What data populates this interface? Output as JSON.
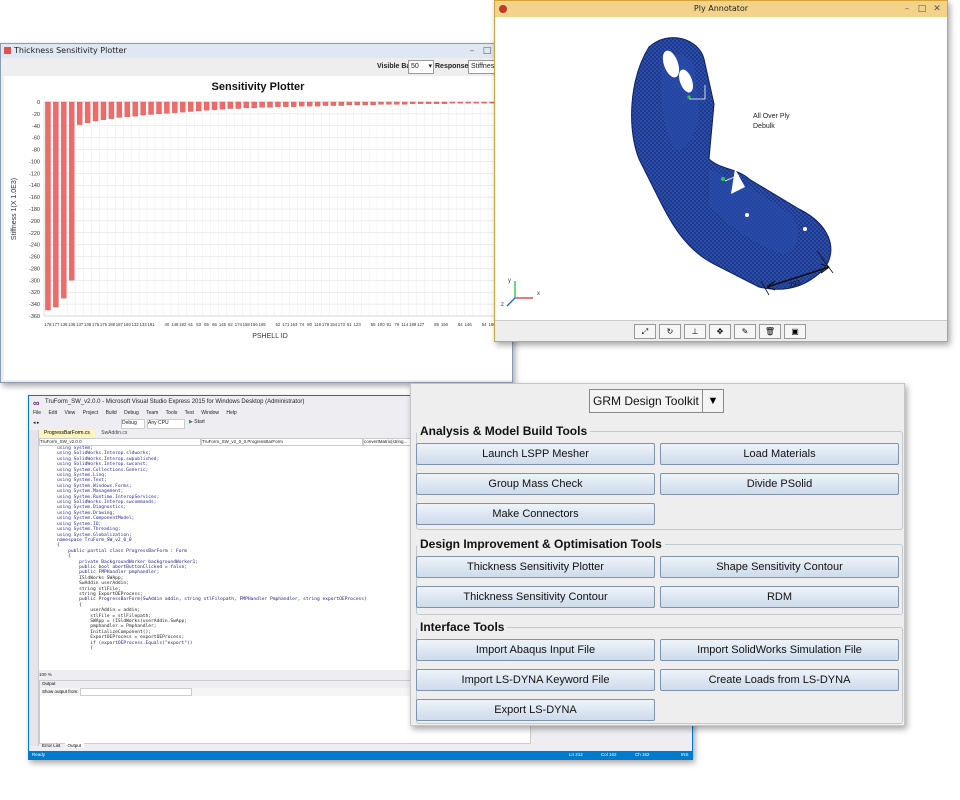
{
  "thickness_window": {
    "title": "Thickness Sensitivity Plotter",
    "visible_bar_label": "Visible Bar",
    "visible_bar_value": "50",
    "responses_label": "Responses",
    "responses_value": "Stiffness",
    "chart_title": "Sensitivity Plotter",
    "y_label": "Stiffness 1(X 1.0E3)",
    "x_label": "PSHELL ID"
  },
  "chart_data": {
    "type": "bar",
    "title": "Sensitivity Plotter",
    "xlabel": "PSHELL ID",
    "ylabel": "Stiffness 1(X 1.0E3)",
    "ylim": [
      -360,
      0
    ],
    "yticks": [
      0,
      -20,
      -40,
      -60,
      -80,
      -100,
      -120,
      -140,
      -160,
      -180,
      -200,
      -220,
      -240,
      -260,
      -280,
      -300,
      -320,
      -340,
      -360
    ],
    "bar_color": "#f06a6a",
    "categories": [
      "178",
      "177",
      "138",
      "136",
      "137",
      "138",
      "176",
      "175",
      "188",
      "187",
      "160",
      "132",
      "133",
      "181",
      "",
      "40",
      "148",
      "182",
      "61",
      "53",
      "65",
      "66",
      "145",
      "62",
      "174",
      "158",
      "156",
      "165",
      "",
      "52",
      "171",
      "163",
      "74",
      "80",
      "119",
      "179",
      "154",
      "173",
      "51",
      "123",
      "",
      "55",
      "100",
      "91",
      "76",
      "114",
      "189",
      "127",
      "",
      "89",
      "150",
      "",
      "84",
      "146",
      "",
      "54",
      "180"
    ],
    "values": [
      -350,
      -345,
      -330,
      -300,
      -38,
      -35,
      -32,
      -30,
      -28,
      -26,
      -25,
      -24,
      -22,
      -21,
      -20,
      -19,
      -18,
      -17,
      -16,
      -15,
      -14,
      -13,
      -12,
      -11,
      -11,
      -10,
      -10,
      -9,
      -9,
      -8,
      -8,
      -8,
      -7,
      -7,
      -7,
      -6,
      -6,
      -6,
      -5,
      -5,
      -5,
      -5,
      -4,
      -4,
      -4,
      -4,
      -3,
      -3,
      -3,
      -3,
      -3,
      -2,
      -2,
      -2,
      -2,
      -2,
      -2
    ]
  },
  "ply_window": {
    "title": "Ply Annotator",
    "label_line1": "All Over Ply",
    "label_line2": "Debulk",
    "dimension": "293",
    "axis_labels": [
      "x",
      "y",
      "z"
    ],
    "toolbar_icons": [
      "fit-icon",
      "rotate-icon",
      "axis-icon",
      "pan-icon",
      "annotate-icon",
      "delete-icon",
      "save-icon"
    ]
  },
  "vs_window": {
    "title": "TruForm_SW_v2.0.0 - Microsoft Visual Studio Express 2015 for Windows Desktop (Administrator)",
    "menu": [
      "File",
      "Edit",
      "View",
      "Project",
      "Build",
      "Debug",
      "Team",
      "Tools",
      "Test",
      "Window",
      "Help"
    ],
    "tabs": [
      "ProgressBarForm.cs",
      "SwAddin.cs"
    ],
    "nav_left": "TruForm_SW_v2.0.0",
    "nav_mid": "TruForm_SW_v2_0_0.ProgressBarForm",
    "nav_right": "convertMatrix(string...",
    "config": "Debug",
    "platform": "Any CPU",
    "start": "Start",
    "code_lines": [
      "using System;",
      "using SolidWorks.Interop.sldworks;",
      "using SolidWorks.Interop.swpublished;",
      "using SolidWorks.Interop.swconst;",
      "using System.Collections.Generic;",
      "using System.Linq;",
      "using System.Text;",
      "using System.Windows.Forms;",
      "using System.Management;",
      "using System.Runtime.InteropServices;",
      "using SolidWorks.Interop.swcommands;",
      "using System.Diagnostics;",
      "using System.Drawing;",
      "using System.ComponentModel;",
      "using System.IO;",
      "using System.Threading;",
      "using System.Globalization;",
      "",
      "namespace TruForm_SW_v2_0_0",
      "{",
      "    public partial class ProgressBarForm : Form",
      "    {",
      "        private BackgroundWorker backgroundWorker1;",
      "        public bool abortButtonClicked = false;",
      "        public FMPHandler pmphandler;",
      "        ISldWorks SWApp;",
      "        SwAddin userAddin;",
      "        string stlFile;",
      "        string ExportOEProcess;",
      "",
      "        public ProgressBarForm(SwAddin addin, string stlFilepath, FMPHandler Pmphandler, string exportOEProcess)",
      "        {",
      "            userAddin = addin;",
      "            stlFile = stlFilepath;",
      "            SWApp = (ISldWorks)userAddin.SwApp;",
      "            pmphandler = Pmphandler;",
      "            InitializeComponent();",
      "            ExportOEProcess = exportOEProcess;",
      "",
      "            if (exportOEProcess.Equals(\"export\"))",
      "            {"
    ],
    "zoom": "100 %",
    "output_title": "Output",
    "show_output_from": "Show output from:",
    "bottom_tabs": [
      "Error List",
      "Output"
    ],
    "status_left": "Ready",
    "status_ln": "Ln 212",
    "status_col": "Col 162",
    "status_ch": "Ch 162",
    "status_ins": "INS"
  },
  "toolkit": {
    "dropdown_label": "GRM Design Toolkit",
    "groups": [
      {
        "title": "Analysis & Model Build Tools",
        "buttons": [
          "Launch LSPP Mesher",
          "Load Materials",
          "Group Mass Check",
          "Divide PSolid",
          "Make Connectors"
        ]
      },
      {
        "title": "Design Improvement & Optimisation Tools",
        "buttons": [
          "Thickness Sensitivity Plotter",
          "Shape Sensitivity Contour",
          "Thickness Sensitivity Contour",
          "RDM"
        ]
      },
      {
        "title": "Interface Tools",
        "buttons": [
          "Import Abaqus Input File",
          "Import SolidWorks Simulation File",
          "Import LS-DYNA Keyword File",
          "Create Loads from LS-DYNA",
          "Export LS-DYNA"
        ]
      }
    ]
  }
}
